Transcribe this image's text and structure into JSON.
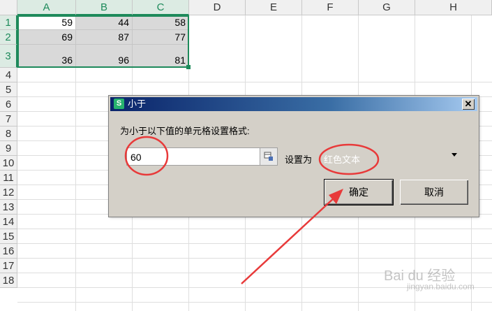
{
  "columns": [
    "A",
    "B",
    "C",
    "D",
    "E",
    "F",
    "G",
    "H"
  ],
  "rows": [
    "1",
    "2",
    "3",
    "4",
    "5",
    "6",
    "7",
    "8",
    "9",
    "10",
    "11",
    "12",
    "13",
    "14",
    "15",
    "16",
    "17",
    "18"
  ],
  "cells": [
    [
      "59",
      "44",
      "58"
    ],
    [
      "69",
      "87",
      "77"
    ],
    [
      "36",
      "96",
      "81"
    ]
  ],
  "dialog": {
    "title": "小于",
    "app_icon": "S",
    "prompt": "为小于以下值的单元格设置格式:",
    "value": "60",
    "set_as_label": "设置为",
    "format_value": "红色文本",
    "ok_label": "确定",
    "cancel_label": "取消",
    "close_glyph": "✕"
  },
  "colors": {
    "selection": "#1e8a5b",
    "annotation": "#e83a3a",
    "titlebar_start": "#0a246a",
    "titlebar_end": "#a6caf0"
  },
  "icons": {
    "reference": "range-select-icon",
    "dropdown": "chevron-down-icon",
    "close": "close-icon"
  },
  "watermark": {
    "brand": "Bai du 经验",
    "url": "jingyan.baidu.com"
  }
}
